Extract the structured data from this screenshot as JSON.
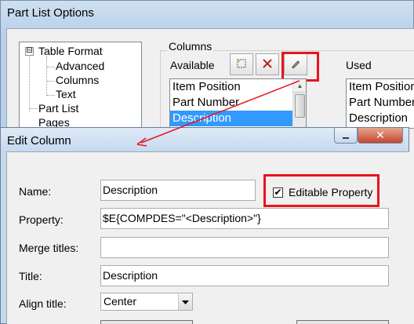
{
  "back_window": {
    "title": "Part List Options",
    "tree": {
      "root": "Table Format",
      "children": [
        "Advanced",
        "Columns",
        "Text"
      ],
      "siblings": [
        "Part List",
        "Pages"
      ],
      "expander": "⊟"
    },
    "columns_group": {
      "legend": "Columns",
      "available_label": "Available",
      "used_label": "Used",
      "toolbar": [
        {
          "name": "new-column",
          "icon": "new-icon"
        },
        {
          "name": "delete-column",
          "icon": "delete-icon"
        },
        {
          "name": "edit-column",
          "icon": "pencil-icon"
        }
      ],
      "available_items": [
        "Item Position",
        "Part Number",
        "Description"
      ],
      "available_selected_index": 2,
      "used_items": [
        "Item Position",
        "Part Number",
        "Description"
      ]
    }
  },
  "dialog": {
    "title": "Edit Column",
    "close_glyph": "✕",
    "fields": {
      "name_label": "Name:",
      "name_value": "Description",
      "property_label": "Property:",
      "property_value": "$E{COMPDES=\"<Description>\"}",
      "merge_titles_label": "Merge titles:",
      "merge_titles_value": "",
      "title_label": "Title:",
      "title_value": "Description",
      "align_title_label": "Align title:",
      "align_title_value": "Center"
    },
    "editable_property": {
      "label": "Editable Property",
      "checked": true,
      "check_glyph": "✔"
    }
  },
  "annotation": {
    "highlight_color": "#e8141c"
  },
  "colors": {
    "selection": "#3399ff",
    "close_button": "#c6462c"
  }
}
